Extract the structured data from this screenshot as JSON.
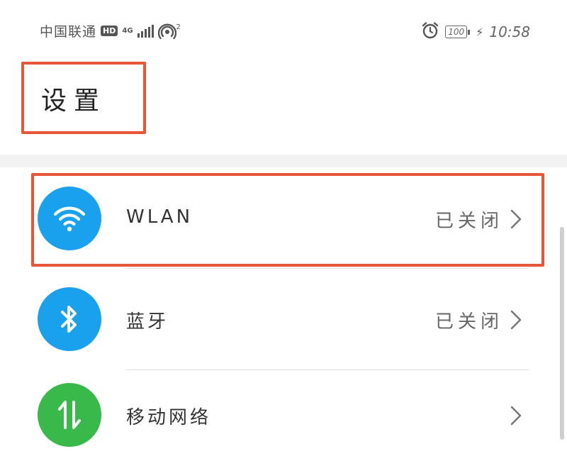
{
  "status_bar": {
    "carrier": "中国联通",
    "hd": "HD",
    "network": "4G",
    "hotspot_count": "2",
    "battery": "100",
    "time": "10:58"
  },
  "header": {
    "title": "设置"
  },
  "settings_items": [
    {
      "label": "WLAN",
      "status": "已关闭",
      "icon": "wifi-icon",
      "color": "#1aa1ee"
    },
    {
      "label": "蓝牙",
      "status": "已关闭",
      "icon": "bluetooth-icon",
      "color": "#1aa1ee"
    },
    {
      "label": "移动网络",
      "status": "",
      "icon": "mobile-data-icon",
      "color": "#38b94a"
    }
  ],
  "colors": {
    "highlight": "#e8563a",
    "accent_blue": "#1aa1ee",
    "accent_green": "#38b94a"
  }
}
